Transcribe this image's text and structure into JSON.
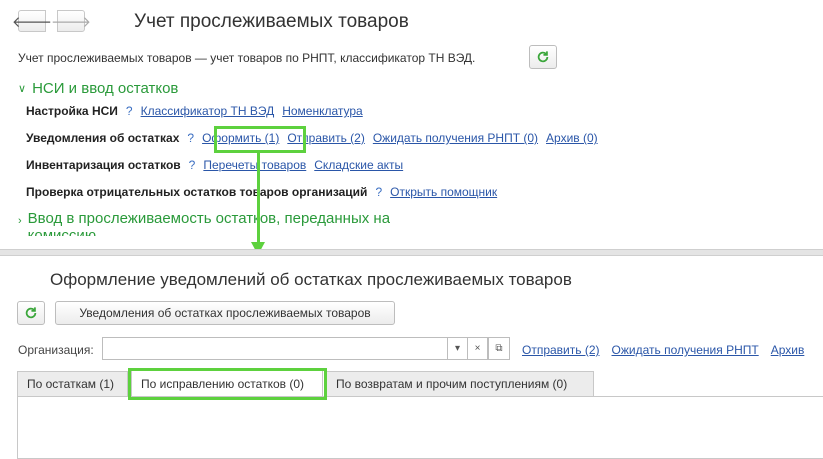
{
  "top": {
    "nav_back_glyph": "🡐",
    "nav_fwd_glyph": "🡒",
    "title": "Учет прослеживаемых товаров",
    "description": "Учет прослеживаемых товаров — учет товаров по РНПТ, классификатор ТН ВЭД.",
    "group1": {
      "title": "НСИ и ввод остатков",
      "rows": {
        "nsi": {
          "label": "Настройка НСИ",
          "q": "?",
          "links": [
            "Классификатор ТН ВЭД",
            "Номенклатура"
          ]
        },
        "notifications": {
          "label": "Уведомления об остатках",
          "q": "?",
          "links": [
            "Оформить (1)",
            "Отправить (2)",
            "Ожидать получения РНПТ (0)",
            "Архив (0)"
          ]
        },
        "inventory": {
          "label": "Инвентаризация остатков",
          "q": "?",
          "links": [
            "Перечеты товаров",
            "Складские акты"
          ]
        },
        "check": {
          "label": "Проверка отрицательных остатков товаров организаций",
          "q": "?",
          "links": [
            "Открыть помощник"
          ]
        }
      }
    },
    "group2": {
      "title_line1": "Ввод в прослеживаемость остатков, переданных на",
      "title_line2": "комиссию"
    }
  },
  "bottom": {
    "title": "Оформление уведомлений об остатках прослеживаемых товаров",
    "notifications_button": "Уведомления об остатках прослеживаемых товаров",
    "org_label": "Организация:",
    "org_value": "",
    "org_buttons": [
      "▾",
      "×",
      "⧉"
    ],
    "links": [
      "Отправить (2)",
      "Ожидать получения РНПТ",
      "Архив"
    ],
    "tabs": [
      "По остаткам (1)",
      "По исправлению остатков (0)",
      "По возвратам и прочим поступлениям (0)"
    ],
    "active_tab": 1
  },
  "colors": {
    "group_header": "#2a9a3a",
    "link": "#2a56a8",
    "highlight": "#5dd13e",
    "refresh_icon": "#3aa63a"
  },
  "icons": [
    "back-arrow-icon",
    "forward-arrow-icon",
    "refresh-icon",
    "chevron-down-icon",
    "chevron-right-icon",
    "help-icon",
    "dropdown-icon",
    "clear-icon",
    "open-icon"
  ]
}
